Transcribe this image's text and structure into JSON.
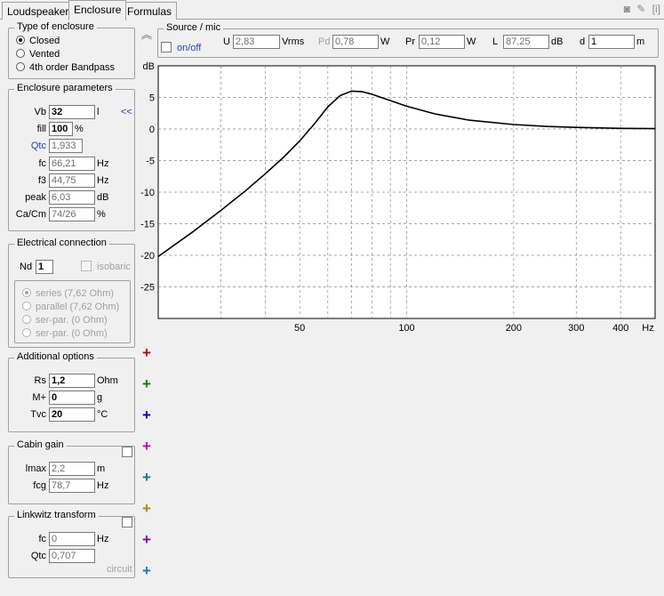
{
  "tabs": [
    "Loudspeaker",
    "Enclosure",
    "Formulas"
  ],
  "type_of_enclosure": {
    "title": "Type of enclosure",
    "options": [
      "Closed",
      "Vented",
      "4th order Bandpass"
    ],
    "selected": 0
  },
  "enclosure_params": {
    "title": "Enclosure parameters",
    "vb": {
      "label": "Vb",
      "value": "32",
      "unit": "l"
    },
    "arrow": "<<",
    "fill": {
      "label": "fill",
      "value": "100",
      "unit": "%"
    },
    "qtc": {
      "label": "Qtc",
      "value": "1,933"
    },
    "fc": {
      "label": "fc",
      "value": "66,21",
      "unit": "Hz"
    },
    "f3": {
      "label": "f3",
      "value": "44,75",
      "unit": "Hz"
    },
    "peak": {
      "label": "peak",
      "value": "6,03",
      "unit": "dB"
    },
    "cacm": {
      "label": "Ca/Cm",
      "value": "74/26",
      "unit": "%"
    }
  },
  "electrical": {
    "title": "Electrical connection",
    "nd_label": "Nd",
    "nd_value": "1",
    "isobaric": "isobaric",
    "options": [
      "series (7,62 Ohm)",
      "parallel (7,62 Ohm)",
      "ser-par. (0 Ohm)",
      "ser-par. (0 Ohm)"
    ]
  },
  "additional": {
    "title": "Additional options",
    "rs": {
      "label": "Rs",
      "value": "1,2",
      "unit": "Ohm"
    },
    "mplus": {
      "label": "M+",
      "value": "0",
      "unit": "g"
    },
    "tvc": {
      "label": "Tvc",
      "value": "20",
      "unit": "°C"
    }
  },
  "cabin": {
    "title": "Cabin gain",
    "lmax": {
      "label": "lmax",
      "value": "2,2",
      "unit": "m"
    },
    "fcg": {
      "label": "fcg",
      "value": "78,7",
      "unit": "Hz"
    }
  },
  "linkwitz": {
    "title": "Linkwitz transform",
    "fc": {
      "label": "fc",
      "value": "0",
      "unit": "Hz"
    },
    "qtc": {
      "label": "Qtc",
      "value": "0,707"
    },
    "circuit": "circuit"
  },
  "source": {
    "title": "Source / mic",
    "onoff": "on/off",
    "u": {
      "label": "U",
      "value": "2,83",
      "unit": "Vrms"
    },
    "pd": {
      "label": "Pd",
      "value": "0,78",
      "unit": "W"
    },
    "pr": {
      "label": "Pr",
      "value": "0,12",
      "unit": "W"
    },
    "l": {
      "label": "L",
      "value": "87,25",
      "unit": "dB"
    },
    "d": {
      "label": "d",
      "value": "1",
      "unit": "m"
    }
  },
  "colors": {
    "plus": [
      "#c00000",
      "#008000",
      "#0000c0",
      "#c000c0",
      "#008080",
      "#c08000",
      "#8000c0",
      "#0080c0"
    ]
  },
  "chart_data": {
    "type": "line",
    "ylabel": "dB",
    "xlabel": "Hz",
    "x_scale": "log",
    "xlim": [
      20,
      500
    ],
    "ylim": [
      -30,
      10
    ],
    "y_ticks": [
      5,
      0,
      -5,
      -10,
      -15,
      -20,
      -25
    ],
    "x_tick_labels": [
      "50",
      "100",
      "200",
      "300",
      "400"
    ],
    "grid": true,
    "series": [
      {
        "x": [
          20,
          25,
          30,
          35,
          40,
          45,
          50,
          55,
          60,
          65,
          70,
          75,
          80,
          90,
          100,
          120,
          150,
          200,
          250,
          300,
          400,
          500
        ],
        "y": [
          -20.2,
          -16.3,
          -12.9,
          -9.9,
          -7.1,
          -4.5,
          -1.9,
          0.8,
          3.5,
          5.3,
          6.0,
          5.9,
          5.5,
          4.5,
          3.6,
          2.4,
          1.4,
          0.7,
          0.4,
          0.25,
          0.1,
          0.05
        ]
      }
    ]
  }
}
